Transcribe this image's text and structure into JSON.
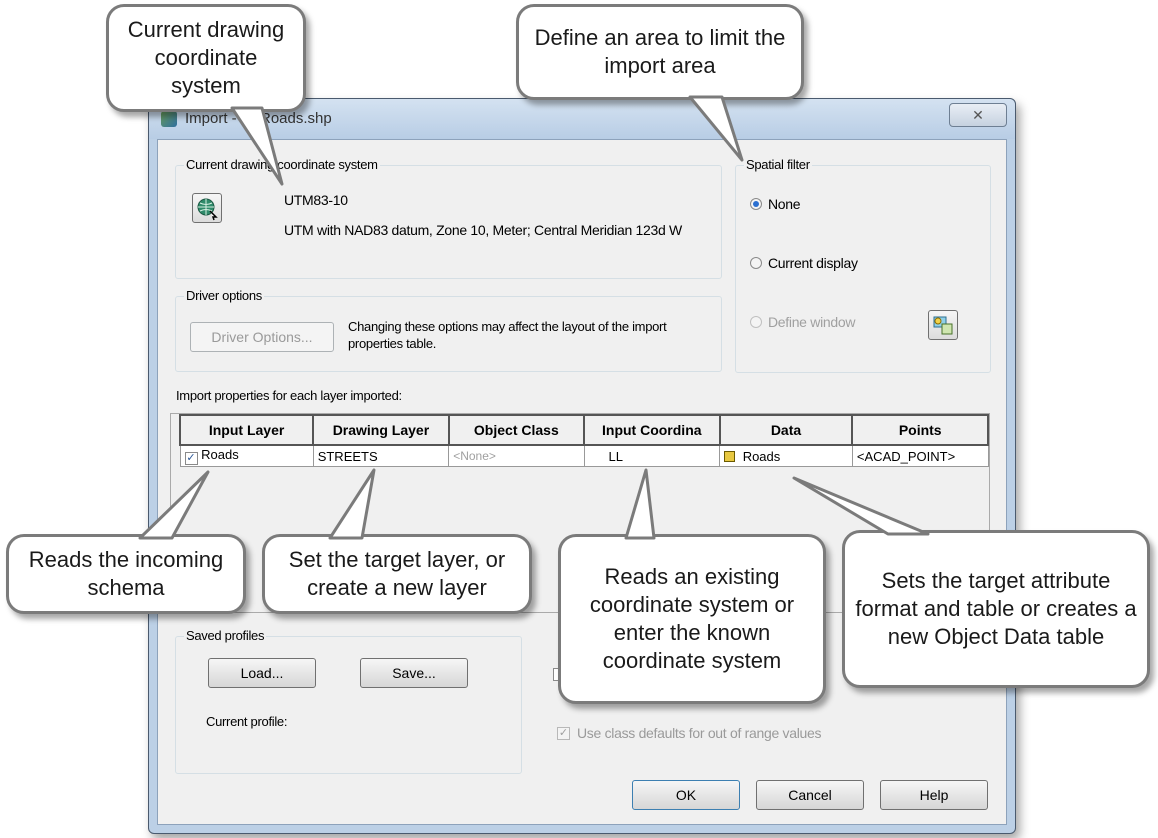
{
  "dialog": {
    "title": "Import - C:\\Roads.shp",
    "close_glyph": "✕",
    "coord_group_label": "Current drawing coordinate system",
    "coord_code": "UTM83-10",
    "coord_desc": "UTM with NAD83 datum, Zone 10, Meter; Central Meridian 123d W",
    "driver_group_label": "Driver options",
    "driver_button_label": "Driver Options...",
    "driver_note": "Changing these options may affect the layout of the import properties table.",
    "spatial_group_label": "Spatial filter",
    "spatial_options": [
      {
        "label": "None",
        "checked": true
      },
      {
        "label": "Current display",
        "checked": false
      },
      {
        "label": "Define window",
        "checked": false
      }
    ],
    "import_props_label": "Import properties for each layer imported:",
    "table": {
      "columns": [
        "Input Layer",
        "Drawing Layer",
        "Object Class",
        "Input Coordina",
        "Data",
        "Points"
      ],
      "rows": [
        {
          "input_layer": "Roads",
          "drawing_layer": "STREETS",
          "object_class": "<None>",
          "input_coord": "LL",
          "data": "Roads",
          "points": "<ACAD_POINT>"
        }
      ]
    },
    "profiles_group_label": "Saved profiles",
    "load_label": "Load...",
    "save_label": "Save...",
    "current_profile_label": "Current profile:",
    "class_defaults_label": "Use class defaults for out of range values",
    "ok_label": "OK",
    "cancel_label": "Cancel",
    "help_label": "Help"
  },
  "callouts": {
    "coord_system": "Current drawing coordinate system",
    "spatial": "Define an area to limit the import area",
    "input_layer": "Reads the incoming schema",
    "drawing_layer": "Set the target layer, or create a new layer",
    "input_coord": "Reads an existing coordinate system or enter the known coordinate system",
    "data": "Sets the target attribute format and table or creates a new Object Data table"
  },
  "colors": {
    "radio_selected": "#2b6fd0",
    "dialog_frame": "#bcd0e6",
    "callout_border": "#7b7b7b"
  }
}
